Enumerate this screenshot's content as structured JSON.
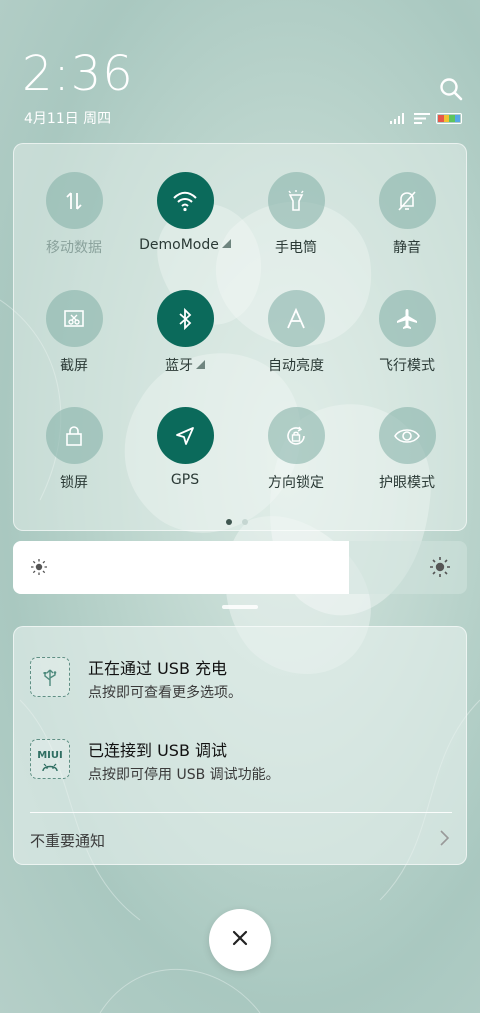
{
  "status": {
    "time": "2:36",
    "date": "4月11日 周四",
    "battery_colors": [
      "#e6574a",
      "#f1c232",
      "#5ec45e",
      "#56a7e7"
    ]
  },
  "quick_settings": {
    "tiles": [
      {
        "label": "移动数据",
        "icon": "updown-arrows-icon",
        "active": false
      },
      {
        "label": "DemoMode",
        "icon": "wifi-icon",
        "active": true
      },
      {
        "label": "手电筒",
        "icon": "flashlight-icon",
        "active": false
      },
      {
        "label": "静音",
        "icon": "bell-off-icon",
        "active": false
      },
      {
        "label": "截屏",
        "icon": "screenshot-icon",
        "active": false
      },
      {
        "label": "蓝牙",
        "icon": "bluetooth-icon",
        "active": true
      },
      {
        "label": "自动亮度",
        "icon": "auto-brightness-icon",
        "active": false
      },
      {
        "label": "飞行模式",
        "icon": "airplane-icon",
        "active": false
      },
      {
        "label": "锁屏",
        "icon": "lock-icon",
        "active": false
      },
      {
        "label": "GPS",
        "icon": "navigation-icon",
        "active": true
      },
      {
        "label": "方向锁定",
        "icon": "rotation-lock-icon",
        "active": false
      },
      {
        "label": "护眼模式",
        "icon": "eye-icon",
        "active": false
      }
    ],
    "page_count": 2,
    "current_page": 1
  },
  "brightness": {
    "level": 0.74
  },
  "notifications": [
    {
      "title": "正在通过 USB 充电",
      "subtitle": "点按即可查看更多选项。",
      "icon": "usb-icon"
    },
    {
      "title": "已连接到 USB 调试",
      "subtitle": "点按即可停用 USB 调试功能。",
      "icon": "miui-icon",
      "icon_text": "MIUI"
    }
  ],
  "unimportant_label": "不重要通知"
}
